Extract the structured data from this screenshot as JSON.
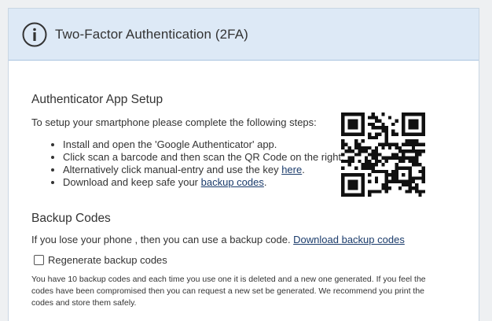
{
  "header": {
    "title": "Two-Factor Authentication (2FA)",
    "icon": "info-icon"
  },
  "authenticator": {
    "title": "Authenticator App Setup",
    "intro": "To setup your smartphone please complete the following steps:",
    "steps": {
      "s1": "Install and open the 'Google Authenticator' app.",
      "s2": "Click scan a barcode and then scan the QR Code on the right.",
      "s3_prefix": "Alternatively click manual-entry and use the key ",
      "s3_link": "here",
      "s3_suffix": ".",
      "s4_prefix": "Download and keep safe your ",
      "s4_link": "backup codes",
      "s4_suffix": "."
    }
  },
  "backup": {
    "title": "Backup Codes",
    "text_prefix": "If you lose your phone , then you can use a backup code. ",
    "download_link": "Download backup codes",
    "regenerate_label": "Regenerate backup codes",
    "regenerate_checked": false,
    "note": "You have 10 backup codes and each time you use one it is deleted and a new one generated. If you feel the codes have been compromised then you can request a new set be generated. We recommend you print the codes and store them safely."
  },
  "colors": {
    "header_bg": "#dde9f6",
    "link": "#1a3b6b",
    "text": "#333333"
  }
}
